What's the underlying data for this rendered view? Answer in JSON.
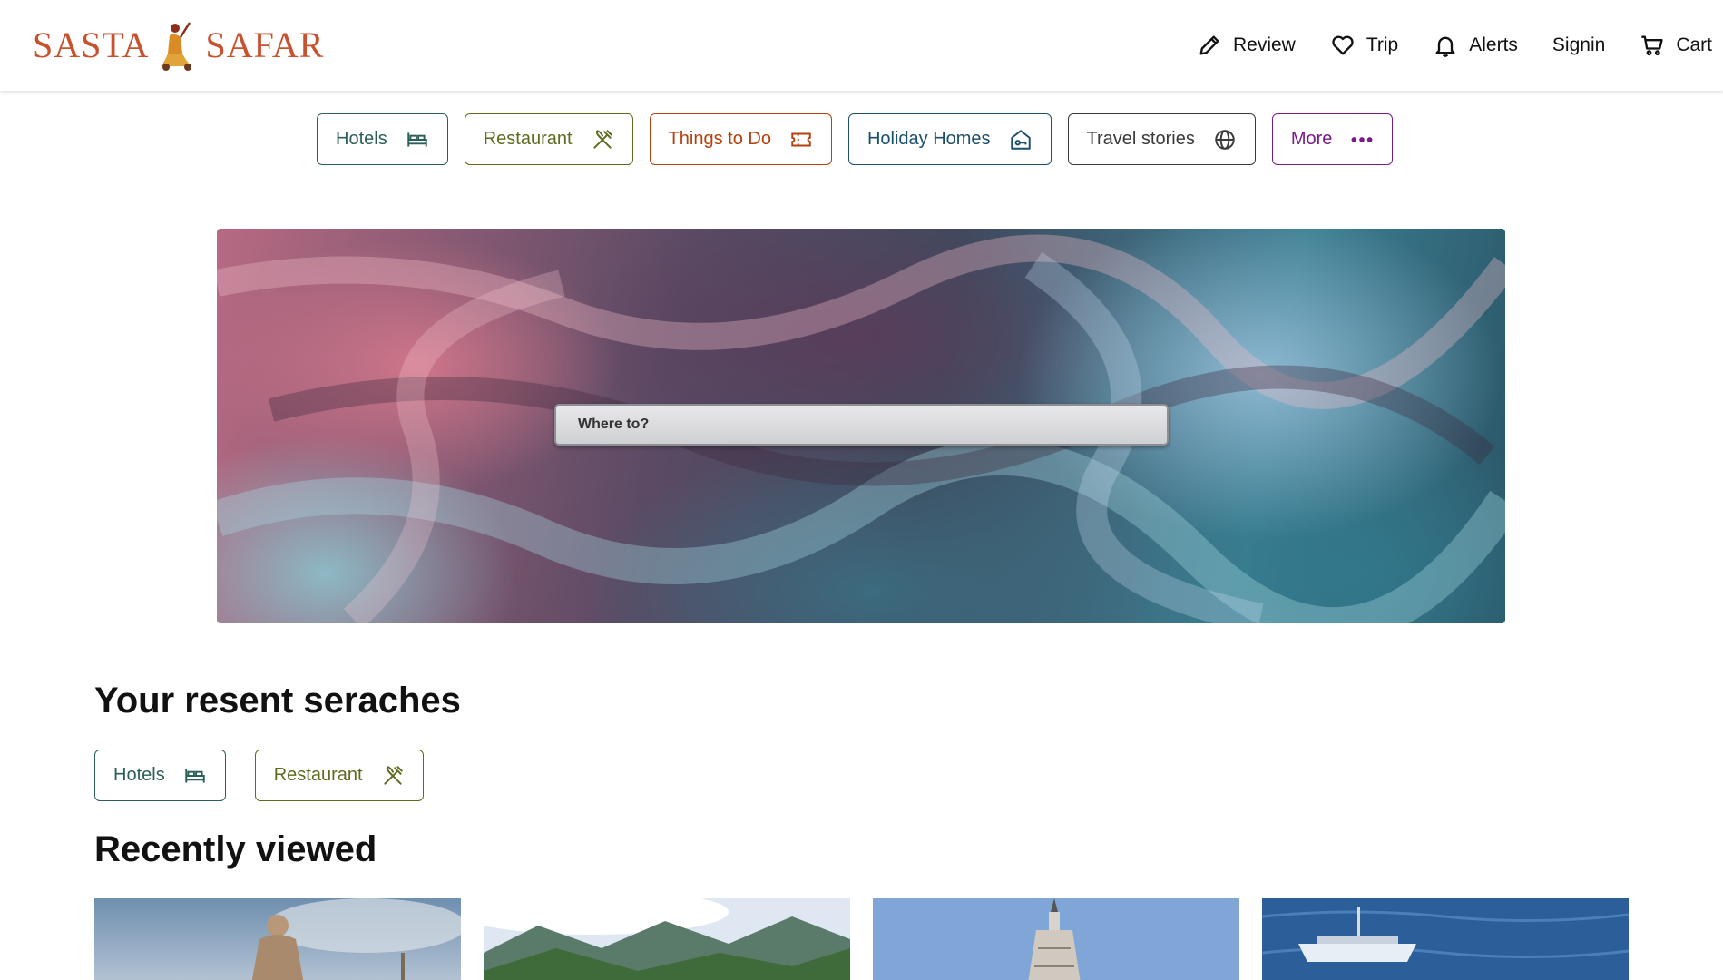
{
  "brand": {
    "name": "SASTA SAFAR",
    "left": "SASTA",
    "right": "SAFAR"
  },
  "nav": [
    {
      "label": "Review",
      "icon": "pencil-icon"
    },
    {
      "label": "Trip",
      "icon": "heart-icon"
    },
    {
      "label": "Alerts",
      "icon": "bell-icon"
    },
    {
      "label": "Signin",
      "icon": ""
    },
    {
      "label": "Cart",
      "icon": "cart-icon"
    }
  ],
  "categories": [
    {
      "label": "Hotels",
      "icon": "bed-icon",
      "color": "#2d5f5a"
    },
    {
      "label": "Restaurant",
      "icon": "fork-knife-icon",
      "color": "#5e6b1e"
    },
    {
      "label": "Things to Do",
      "icon": "ticket-icon",
      "color": "#b3400f"
    },
    {
      "label": "Holiday Homes",
      "icon": "home-icon",
      "color": "#1c4f6b"
    },
    {
      "label": "Travel stories",
      "icon": "globe-icon",
      "color": "#3a3a3a"
    },
    {
      "label": "More",
      "icon": "more-icon",
      "color": "#7b1a8a"
    }
  ],
  "hero": {
    "search_placeholder": "Where to?"
  },
  "recent": {
    "title": "Your resent seraches",
    "items": [
      {
        "label": "Hotels",
        "icon": "bed-icon"
      },
      {
        "label": "Restaurant",
        "icon": "fork-knife-icon"
      }
    ]
  },
  "recently_viewed": {
    "title": "Recently viewed",
    "cards": [
      {
        "image": "buddha-statue-image"
      },
      {
        "image": "mountain-valley-image"
      },
      {
        "image": "stupa-tower-image"
      },
      {
        "image": "sea-boat-image"
      }
    ]
  }
}
